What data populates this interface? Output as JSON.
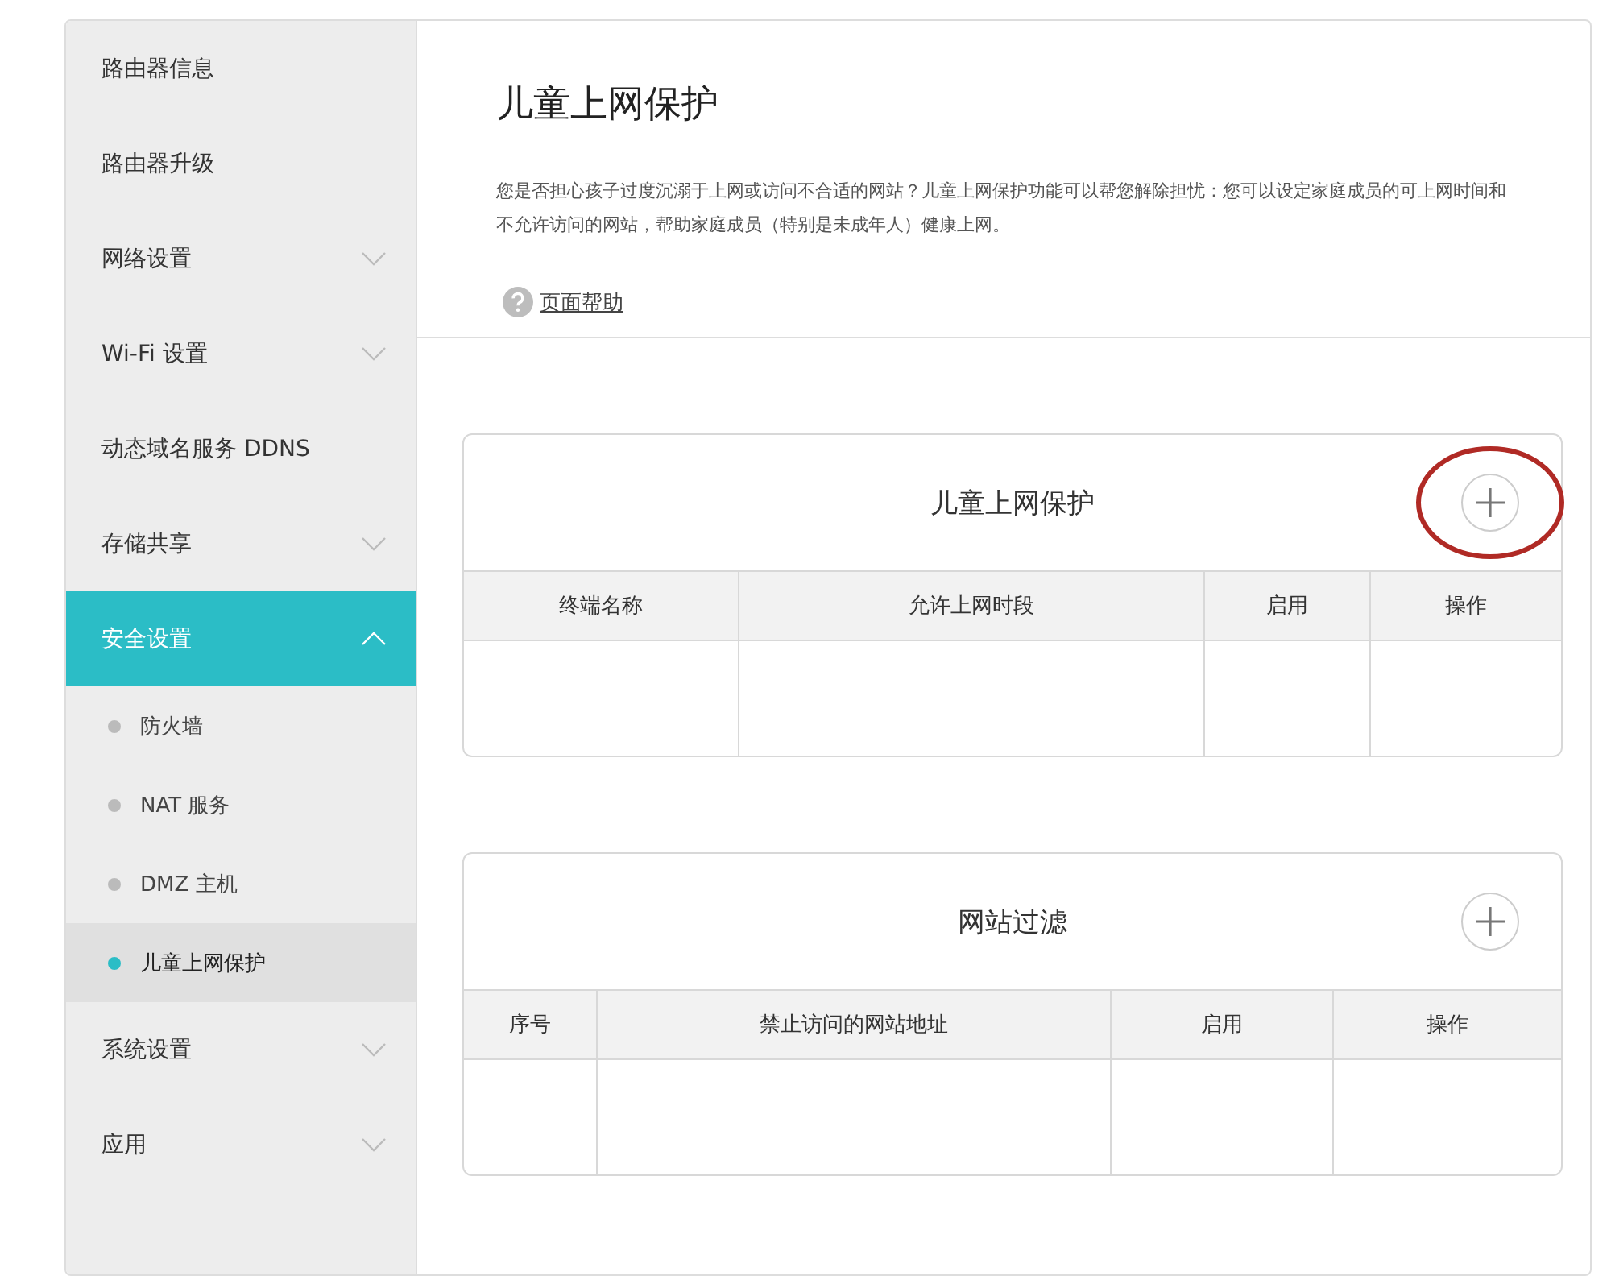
{
  "sidebar": {
    "items": [
      {
        "label": "路由器信息",
        "kind": "link",
        "selected": false
      },
      {
        "label": "路由器升级",
        "kind": "link",
        "selected": false
      },
      {
        "label": "网络设置",
        "kind": "group",
        "expanded": false,
        "selected": false
      },
      {
        "label": "Wi-Fi 设置",
        "kind": "group",
        "expanded": false,
        "selected": false
      },
      {
        "label": "动态域名服务 DDNS",
        "kind": "link",
        "selected": false
      },
      {
        "label": "存储共享",
        "kind": "group",
        "expanded": false,
        "selected": false
      },
      {
        "label": "安全设置",
        "kind": "group",
        "expanded": true,
        "selected": true,
        "children": [
          {
            "label": "防火墙",
            "selected": false
          },
          {
            "label": "NAT 服务",
            "selected": false
          },
          {
            "label": "DMZ 主机",
            "selected": false
          },
          {
            "label": "儿童上网保护",
            "selected": true
          }
        ]
      },
      {
        "label": "系统设置",
        "kind": "group",
        "expanded": false,
        "selected": false
      },
      {
        "label": "应用",
        "kind": "group",
        "expanded": false,
        "selected": false
      }
    ]
  },
  "page": {
    "title": "儿童上网保护",
    "description": "您是否担心孩子过度沉溺于上网或访问不合适的网站？儿童上网保护功能可以帮您解除担忧：您可以设定家庭成员的可上网时间和不允许访问的网站，帮助家庭成员（特别是未成年人）健康上网。",
    "help_link": "页面帮助"
  },
  "panels": [
    {
      "title": "儿童上网保护",
      "annotated": true,
      "columns": [
        "终端名称",
        "允许上网时段",
        "启用",
        "操作"
      ]
    },
    {
      "title": "网站过滤",
      "annotated": false,
      "columns": [
        "序号",
        "禁止访问的网站地址",
        "启用",
        "操作"
      ]
    }
  ]
}
